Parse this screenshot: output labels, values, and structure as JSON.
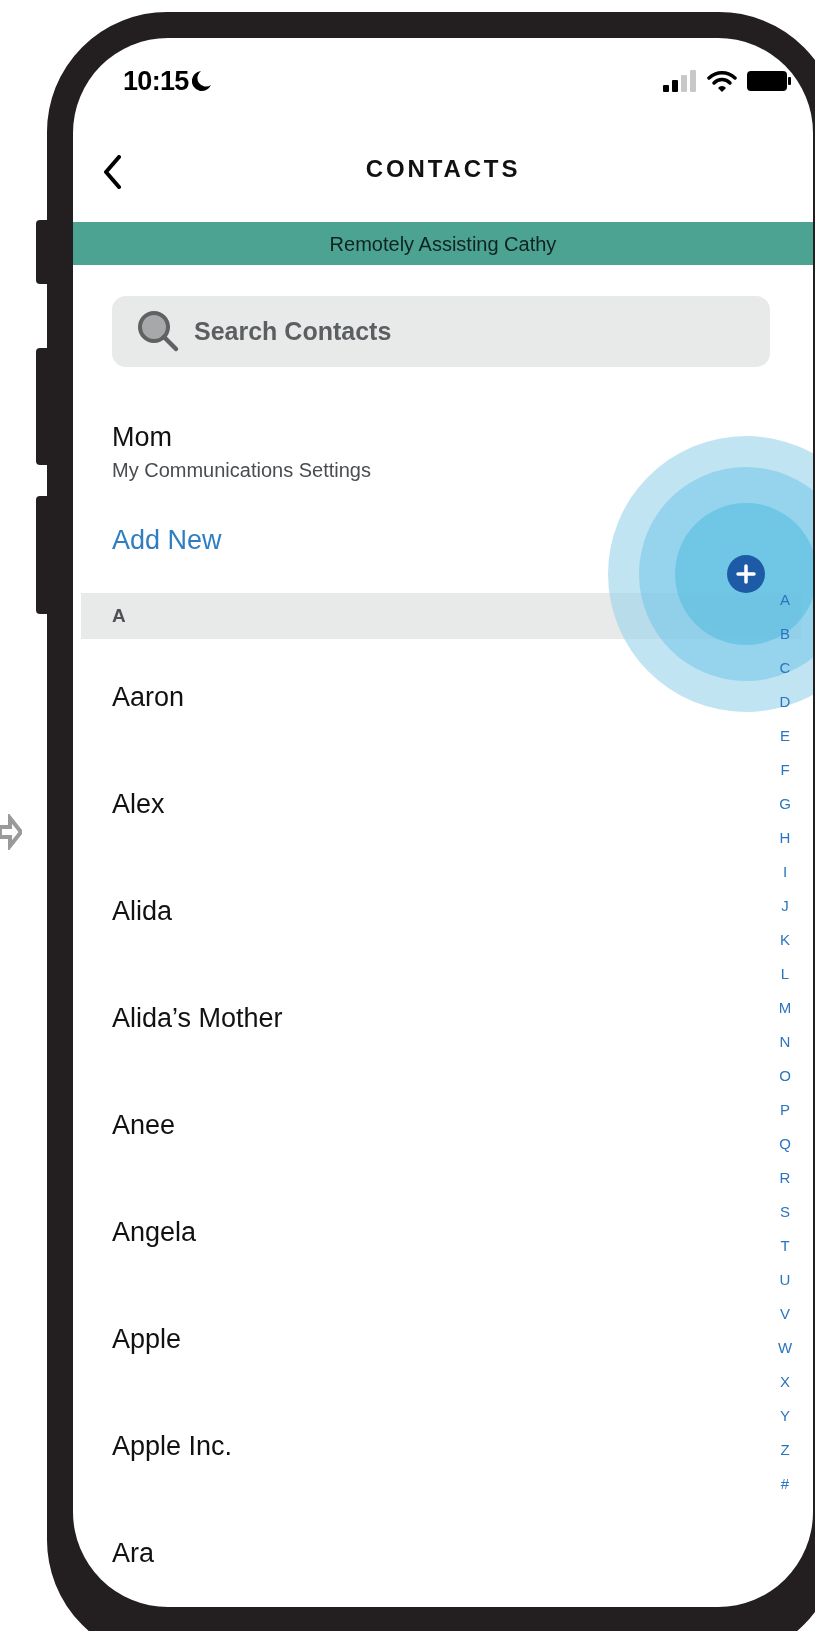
{
  "status_bar": {
    "time": "10:15"
  },
  "header": {
    "title": "CONTACTS"
  },
  "banner": {
    "text": "Remotely Assisting Cathy"
  },
  "search": {
    "placeholder": "Search Contacts"
  },
  "my_card": {
    "name": "Mom",
    "subtitle": "My Communications Settings"
  },
  "add_new": {
    "label": "Add New"
  },
  "sections": [
    {
      "letter": "A",
      "contacts": [
        "Aaron",
        "Alex",
        "Alida",
        "Alida’s Mother",
        "Anee",
        "Angela",
        "Apple",
        "Apple Inc.",
        "Ara"
      ]
    }
  ],
  "index": [
    "A",
    "B",
    "C",
    "D",
    "E",
    "F",
    "G",
    "H",
    "I",
    "J",
    "K",
    "L",
    "M",
    "N",
    "O",
    "P",
    "Q",
    "R",
    "S",
    "T",
    "U",
    "V",
    "W",
    "X",
    "Y",
    "Z",
    "#"
  ]
}
